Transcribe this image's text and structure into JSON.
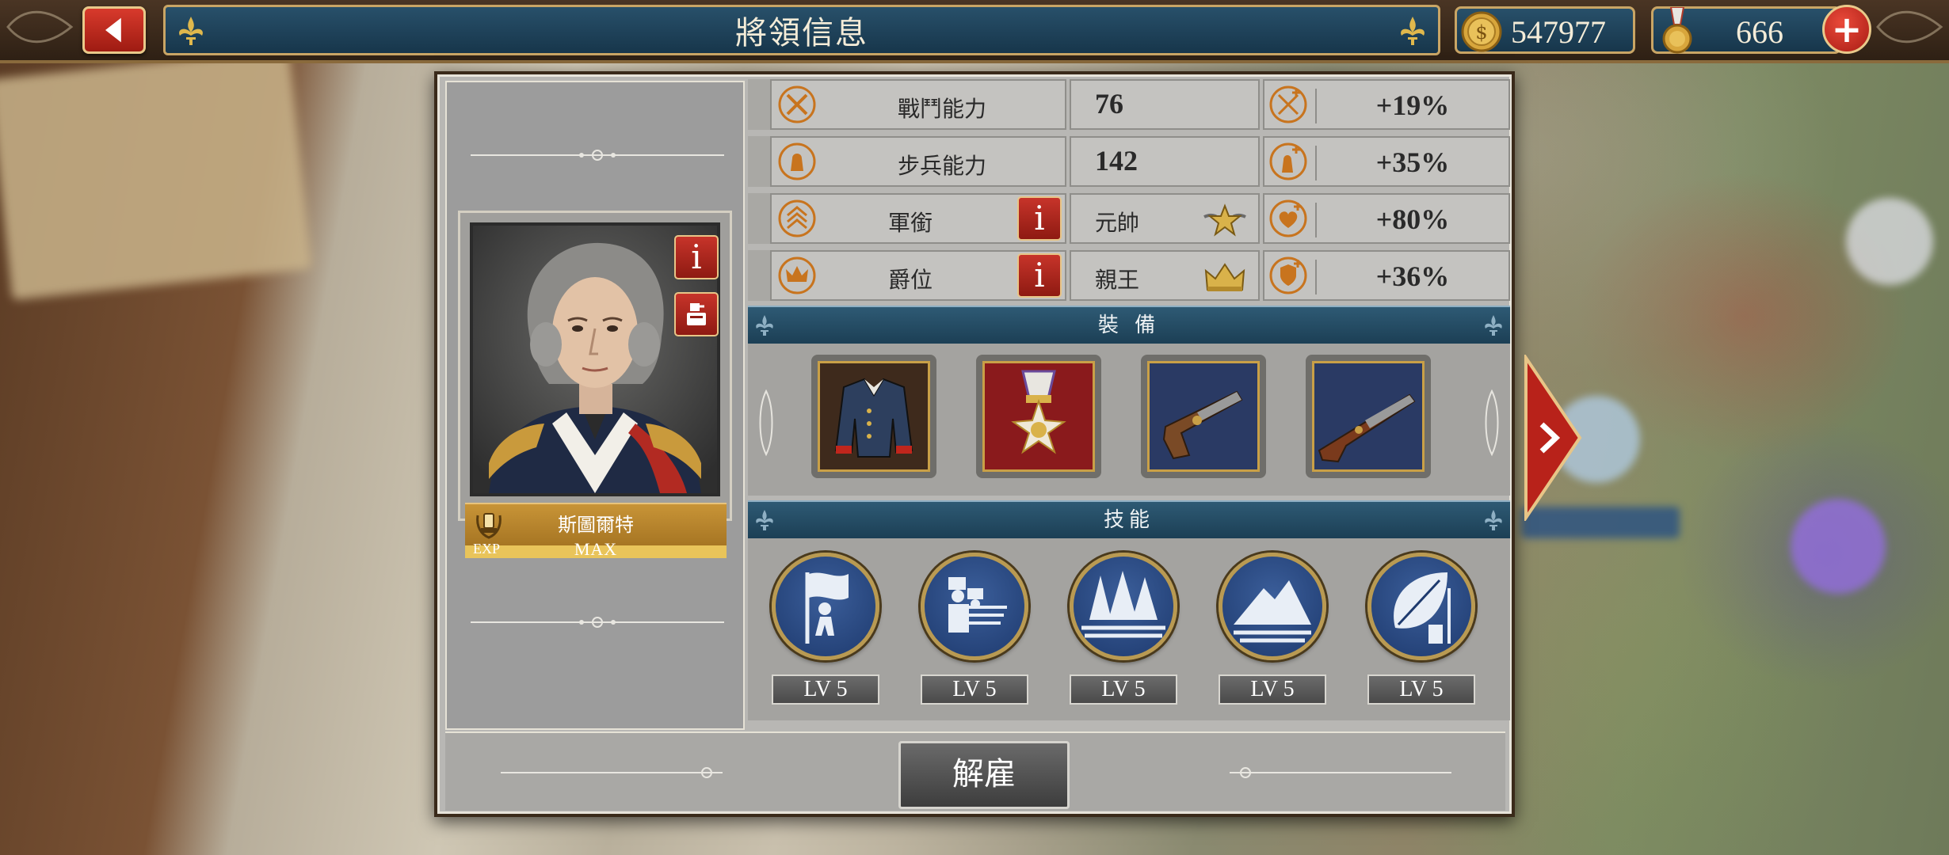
{
  "header": {
    "title": "將領信息",
    "gold": "547977",
    "medals": "666"
  },
  "general": {
    "name": "斯圖爾特",
    "exp_label": "EXP",
    "exp_value": "MAX"
  },
  "stats": [
    {
      "label": "戰鬥能力",
      "value": "76",
      "bonus": "+19%"
    },
    {
      "label": "步兵能力",
      "value": "142",
      "bonus": "+35%"
    },
    {
      "label": "軍銜",
      "value": "元帥",
      "bonus": "+80%"
    },
    {
      "label": "爵位",
      "value": "親王",
      "bonus": "+36%"
    }
  ],
  "equipment": {
    "title": "裝 備",
    "items": [
      "uniform-icon",
      "medal-icon",
      "pistol-icon",
      "musket-icon"
    ]
  },
  "skills": {
    "title": "技能",
    "items": [
      {
        "icon": "flag-bearer-icon",
        "level": "LV 5"
      },
      {
        "icon": "infantry-volley-icon",
        "level": "LV 5"
      },
      {
        "icon": "forest-terrain-icon",
        "level": "LV 5"
      },
      {
        "icon": "mountain-terrain-icon",
        "level": "LV 5"
      },
      {
        "icon": "leaf-defense-icon",
        "level": "LV 5"
      }
    ]
  },
  "actions": {
    "dismiss_label": "解雇"
  },
  "colors": {
    "accent_red": "#c7342a",
    "header_blue": "#1c3f55",
    "gold_trim": "#c9a565",
    "exp_bar": "#e9c45a"
  }
}
